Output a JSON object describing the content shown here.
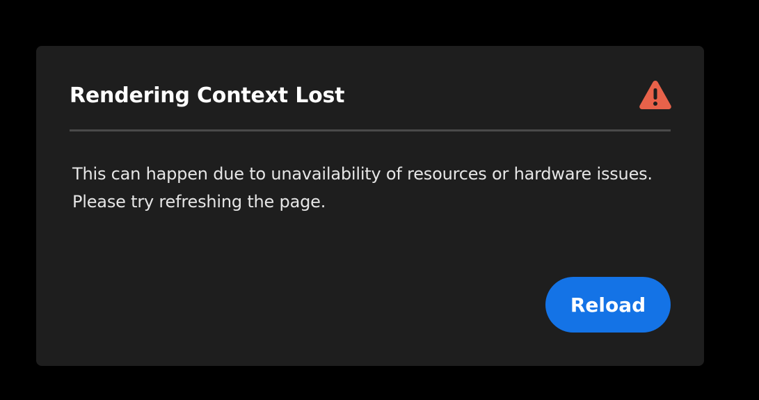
{
  "dialog": {
    "title": "Rendering Context Lost",
    "icon": "alert-triangle-icon",
    "body_line_1": "This can happen due to unavailability of resources or hardware issues.",
    "body_line_2": "Please try refreshing the page.",
    "reload_label": "Reload"
  },
  "colors": {
    "page_background": "#000000",
    "dialog_background": "#1e1e1e",
    "warning": "#e8624a",
    "accent": "#1473e6",
    "divider": "#4a4a4a"
  }
}
